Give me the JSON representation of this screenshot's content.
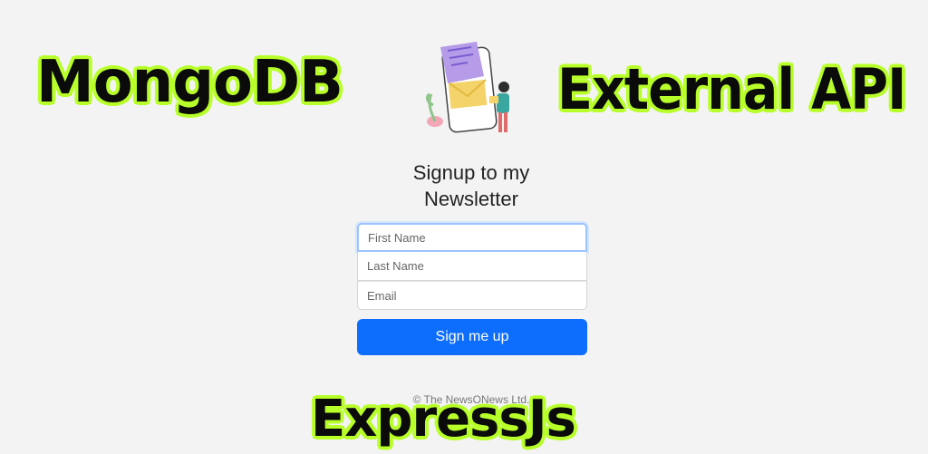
{
  "overlay": {
    "mongodb": "MongoDB",
    "external_api": "External API",
    "expressjs": "ExpressJs"
  },
  "illustration": {
    "icon": "newsletter-illustration-icon"
  },
  "form": {
    "title": "Signup to my Newsletter",
    "first_name_placeholder": "First Name",
    "last_name_placeholder": "Last Name",
    "email_placeholder": "Email",
    "submit_label": "Sign me up"
  },
  "footer": {
    "copyright": "© The NewsONews Ltd."
  },
  "colors": {
    "primary": "#0d6efd",
    "overlay_outline": "#b8ff2a",
    "overlay_text": "#0b0b0b",
    "background": "#f3f3f3"
  }
}
